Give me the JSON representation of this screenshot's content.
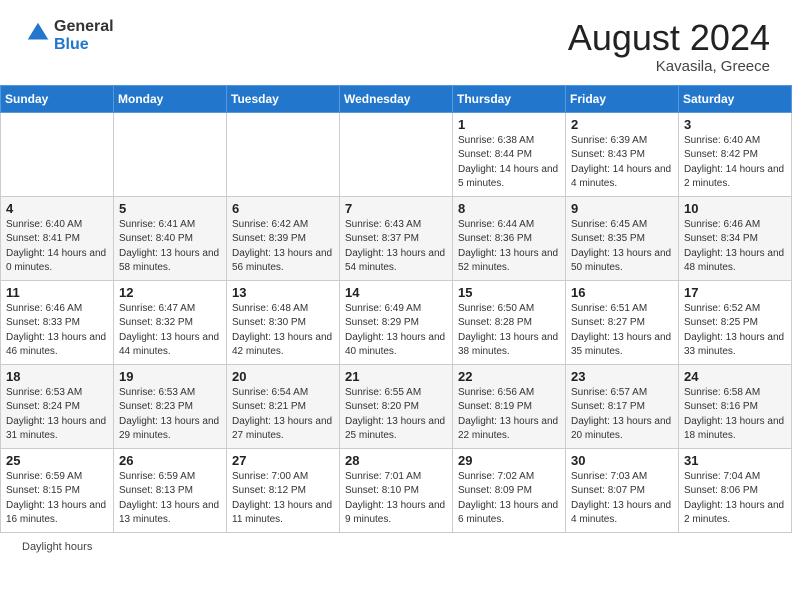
{
  "header": {
    "logo_general": "General",
    "logo_blue": "Blue",
    "month_year": "August 2024",
    "location": "Kavasila, Greece"
  },
  "days_of_week": [
    "Sunday",
    "Monday",
    "Tuesday",
    "Wednesday",
    "Thursday",
    "Friday",
    "Saturday"
  ],
  "weeks": [
    [
      {
        "day": "",
        "info": ""
      },
      {
        "day": "",
        "info": ""
      },
      {
        "day": "",
        "info": ""
      },
      {
        "day": "",
        "info": ""
      },
      {
        "day": "1",
        "info": "Sunrise: 6:38 AM\nSunset: 8:44 PM\nDaylight: 14 hours and 5 minutes."
      },
      {
        "day": "2",
        "info": "Sunrise: 6:39 AM\nSunset: 8:43 PM\nDaylight: 14 hours and 4 minutes."
      },
      {
        "day": "3",
        "info": "Sunrise: 6:40 AM\nSunset: 8:42 PM\nDaylight: 14 hours and 2 minutes."
      }
    ],
    [
      {
        "day": "4",
        "info": "Sunrise: 6:40 AM\nSunset: 8:41 PM\nDaylight: 14 hours and 0 minutes."
      },
      {
        "day": "5",
        "info": "Sunrise: 6:41 AM\nSunset: 8:40 PM\nDaylight: 13 hours and 58 minutes."
      },
      {
        "day": "6",
        "info": "Sunrise: 6:42 AM\nSunset: 8:39 PM\nDaylight: 13 hours and 56 minutes."
      },
      {
        "day": "7",
        "info": "Sunrise: 6:43 AM\nSunset: 8:37 PM\nDaylight: 13 hours and 54 minutes."
      },
      {
        "day": "8",
        "info": "Sunrise: 6:44 AM\nSunset: 8:36 PM\nDaylight: 13 hours and 52 minutes."
      },
      {
        "day": "9",
        "info": "Sunrise: 6:45 AM\nSunset: 8:35 PM\nDaylight: 13 hours and 50 minutes."
      },
      {
        "day": "10",
        "info": "Sunrise: 6:46 AM\nSunset: 8:34 PM\nDaylight: 13 hours and 48 minutes."
      }
    ],
    [
      {
        "day": "11",
        "info": "Sunrise: 6:46 AM\nSunset: 8:33 PM\nDaylight: 13 hours and 46 minutes."
      },
      {
        "day": "12",
        "info": "Sunrise: 6:47 AM\nSunset: 8:32 PM\nDaylight: 13 hours and 44 minutes."
      },
      {
        "day": "13",
        "info": "Sunrise: 6:48 AM\nSunset: 8:30 PM\nDaylight: 13 hours and 42 minutes."
      },
      {
        "day": "14",
        "info": "Sunrise: 6:49 AM\nSunset: 8:29 PM\nDaylight: 13 hours and 40 minutes."
      },
      {
        "day": "15",
        "info": "Sunrise: 6:50 AM\nSunset: 8:28 PM\nDaylight: 13 hours and 38 minutes."
      },
      {
        "day": "16",
        "info": "Sunrise: 6:51 AM\nSunset: 8:27 PM\nDaylight: 13 hours and 35 minutes."
      },
      {
        "day": "17",
        "info": "Sunrise: 6:52 AM\nSunset: 8:25 PM\nDaylight: 13 hours and 33 minutes."
      }
    ],
    [
      {
        "day": "18",
        "info": "Sunrise: 6:53 AM\nSunset: 8:24 PM\nDaylight: 13 hours and 31 minutes."
      },
      {
        "day": "19",
        "info": "Sunrise: 6:53 AM\nSunset: 8:23 PM\nDaylight: 13 hours and 29 minutes."
      },
      {
        "day": "20",
        "info": "Sunrise: 6:54 AM\nSunset: 8:21 PM\nDaylight: 13 hours and 27 minutes."
      },
      {
        "day": "21",
        "info": "Sunrise: 6:55 AM\nSunset: 8:20 PM\nDaylight: 13 hours and 25 minutes."
      },
      {
        "day": "22",
        "info": "Sunrise: 6:56 AM\nSunset: 8:19 PM\nDaylight: 13 hours and 22 minutes."
      },
      {
        "day": "23",
        "info": "Sunrise: 6:57 AM\nSunset: 8:17 PM\nDaylight: 13 hours and 20 minutes."
      },
      {
        "day": "24",
        "info": "Sunrise: 6:58 AM\nSunset: 8:16 PM\nDaylight: 13 hours and 18 minutes."
      }
    ],
    [
      {
        "day": "25",
        "info": "Sunrise: 6:59 AM\nSunset: 8:15 PM\nDaylight: 13 hours and 16 minutes."
      },
      {
        "day": "26",
        "info": "Sunrise: 6:59 AM\nSunset: 8:13 PM\nDaylight: 13 hours and 13 minutes."
      },
      {
        "day": "27",
        "info": "Sunrise: 7:00 AM\nSunset: 8:12 PM\nDaylight: 13 hours and 11 minutes."
      },
      {
        "day": "28",
        "info": "Sunrise: 7:01 AM\nSunset: 8:10 PM\nDaylight: 13 hours and 9 minutes."
      },
      {
        "day": "29",
        "info": "Sunrise: 7:02 AM\nSunset: 8:09 PM\nDaylight: 13 hours and 6 minutes."
      },
      {
        "day": "30",
        "info": "Sunrise: 7:03 AM\nSunset: 8:07 PM\nDaylight: 13 hours and 4 minutes."
      },
      {
        "day": "31",
        "info": "Sunrise: 7:04 AM\nSunset: 8:06 PM\nDaylight: 13 hours and 2 minutes."
      }
    ]
  ],
  "footer": {
    "note": "Daylight hours"
  }
}
